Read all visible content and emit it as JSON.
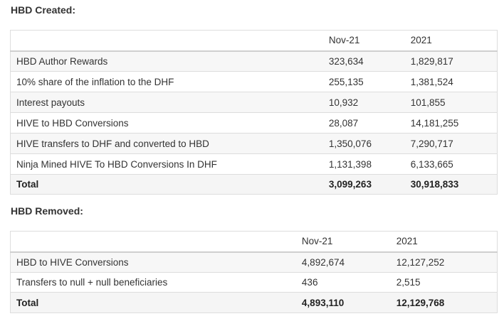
{
  "created": {
    "heading": "HBD Created:",
    "columns": [
      "",
      "Nov-21",
      "2021"
    ],
    "rows": [
      {
        "label": "HBD Author Rewards",
        "nov": "323,634",
        "year": "1,829,817"
      },
      {
        "label": "10% share of the inflation to the DHF",
        "nov": "255,135",
        "year": "1,381,524"
      },
      {
        "label": "Interest payouts",
        "nov": "10,932",
        "year": "101,855"
      },
      {
        "label": "HIVE to HBD Conversions",
        "nov": "28,087",
        "year": "14,181,255"
      },
      {
        "label": "HIVE transfers to DHF and converted to HBD",
        "nov": "1,350,076",
        "year": "7,290,717"
      },
      {
        "label": "Ninja Mined HIVE To HBD Conversions In DHF",
        "nov": "1,131,398",
        "year": "6,133,665"
      }
    ],
    "total": {
      "label": "Total",
      "nov": "3,099,263",
      "year": "30,918,833"
    }
  },
  "removed": {
    "heading": "HBD Removed:",
    "columns": [
      "",
      "Nov-21",
      "2021"
    ],
    "rows": [
      {
        "label": "HBD to HIVE Conversions",
        "nov": "4,892,674",
        "year": "12,127,252"
      },
      {
        "label": "Transfers to null + null beneficiaries",
        "nov": "436",
        "year": "2,515"
      }
    ],
    "total": {
      "label": "Total",
      "nov": "4,893,110",
      "year": "12,129,768"
    }
  }
}
